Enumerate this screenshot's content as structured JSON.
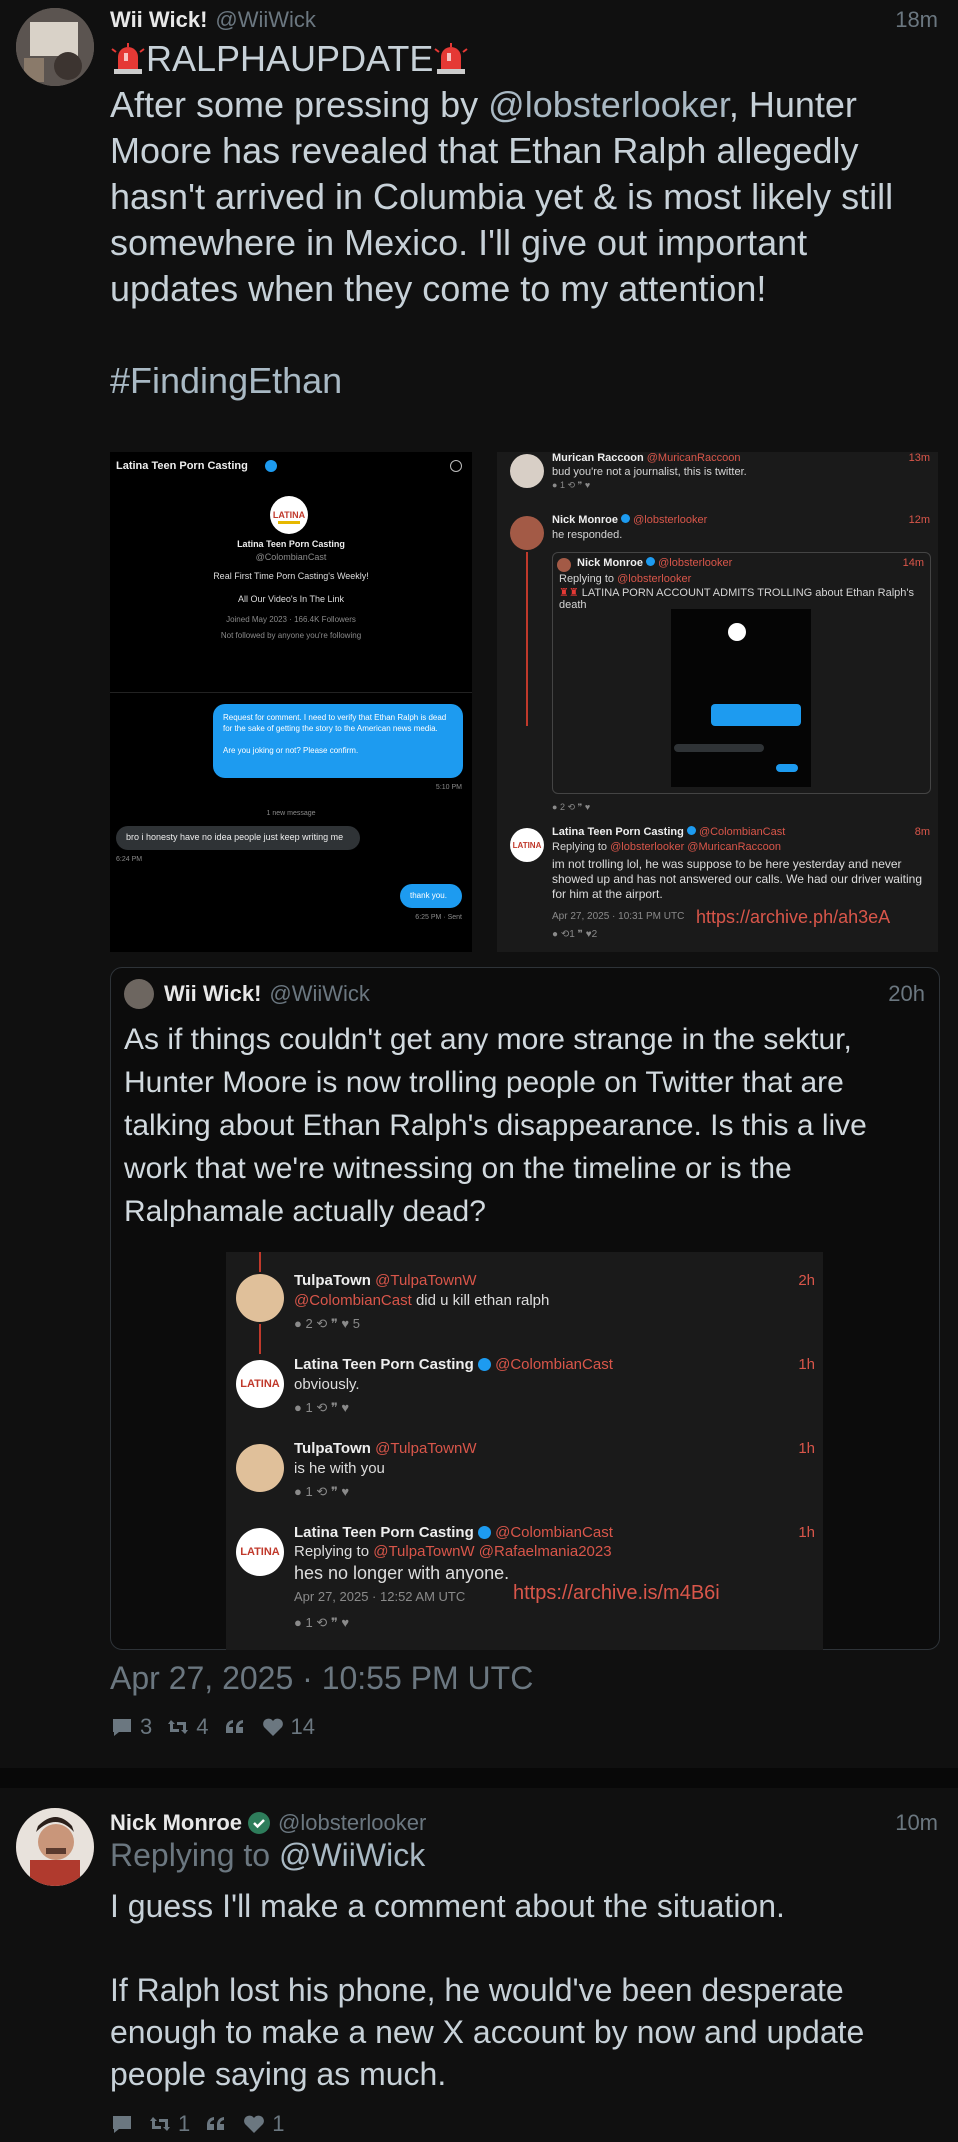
{
  "tweet1": {
    "fullname": "Wii Wick!",
    "handle": "@WiiWick",
    "time": "18m",
    "headline": "RALPHAUPDATE",
    "text_before_mention": "After some pressing by ",
    "mention": "@lobsterlooker",
    "text_after_mention": ", Hunter Moore has revealed that Ethan Ralph allegedly hasn't arrived in Columbia yet & is most likely still somewhere in Mexico. I'll give out important updates when they come to my attention!",
    "hashtag": "#FindingEthan",
    "date": "Apr 27, 2025 · 10:55 PM UTC",
    "stats": {
      "replies": "3",
      "retweets": "4",
      "quotes": "",
      "likes": "14"
    }
  },
  "left_image": {
    "profile_name": "Latina Teen Porn Casting",
    "profile_handle": "@ColombianCast",
    "bio1": "Real First Time Porn Casting's Weekly!",
    "bio2": "All Our Video's In The Link",
    "joined": "Joined May 2023 · 166.4K Followers",
    "not_followed": "Not followed by anyone you're following",
    "sent_msg": "Request for comment. I need to verify that Ethan Ralph is dead for the sake of getting the story to the American news media.\n\nAre you joking or not? Please confirm.",
    "sent_time": "5:10 PM",
    "new_message": "1 new message",
    "recv_msg": "bro i honesty have no idea people just keep writing me",
    "recv_time": "6:24 PM",
    "thank_you": "thank you.",
    "thank_time": "6:25 PM · Sent"
  },
  "right_image": {
    "r1_name": "Murican Raccoon",
    "r1_handle": "@MuricanRaccoon",
    "r1_time": "13m",
    "r1_text": "bud you're not a journalist, this is twitter.",
    "r1_stats": "1",
    "r2_name": "Nick Monroe",
    "r2_handle": "@lobsterlooker",
    "r2_time": "12m",
    "r2_text": "he responded.",
    "r3_name": "Nick Monroe",
    "r3_handle": "@lobsterlooker",
    "r3_time": "14m",
    "r3_replying": "Replying to",
    "r3_replying_handle": "@lobsterlooker",
    "r3_text": "LATINA PORN ACCOUNT ADMITS TROLLING about Ethan Ralph's death",
    "r3_stats": "2",
    "r4_name": "Latina Teen Porn Casting",
    "r4_handle": "@ColombianCast",
    "r4_time": "8m",
    "r4_replying": "Replying to",
    "r4_replying_handles": "@lobsterlooker @MuricanRaccoon",
    "r4_text": "im not trolling lol, he was suppose to be here yesterday and never showed up and has not answered our calls. We had our driver waiting for him at the airport.",
    "r4_date": "Apr 27, 2025 · 10:31 PM UTC",
    "r4_archive": "https://archive.ph/ah3eA",
    "r4_rts": "1",
    "r4_likes": "2"
  },
  "quote": {
    "fullname": "Wii Wick!",
    "handle": "@WiiWick",
    "time": "20h",
    "text": "As if things couldn't get any more strange in the sektur, Hunter Moore is now trolling people on Twitter that are talking about Ethan Ralph's disappearance. Is this a live work that we're witnessing on the timeline or is the Ralphamale actually dead?",
    "img": {
      "q1_name": "TulpaTown",
      "q1_handle": "@TulpaTownW",
      "q1_time": "2h",
      "q1_mention": "@ColombianCast",
      "q1_text": " did u kill ethan ralph",
      "q1_replies": "2",
      "q1_likes": "5",
      "q2_name": "Latina Teen Porn Casting",
      "q2_handle": "@ColombianCast",
      "q2_time": "1h",
      "q2_text": "obviously.",
      "q2_replies": "1",
      "q3_name": "TulpaTown",
      "q3_handle": "@TulpaTownW",
      "q3_time": "1h",
      "q3_text": "is he with you",
      "q3_replies": "1",
      "q4_name": "Latina Teen Porn Casting",
      "q4_handle": "@ColombianCast",
      "q4_time": "1h",
      "q4_replying": "Replying to",
      "q4_replying_handles": "@TulpaTownW @Rafaelmania2023",
      "q4_text": "hes no longer with anyone.",
      "q4_date": "Apr 27, 2025 · 12:52 AM UTC",
      "q4_archive": "https://archive.is/m4B6i",
      "q4_replies": "1"
    }
  },
  "tweet2": {
    "fullname": "Nick Monroe",
    "handle": "@lobsterlooker",
    "time": "10m",
    "replying_label": "Replying to",
    "replying_handle": "@WiiWick",
    "text": "I guess I'll make a comment about the situation.\n\nIf Ralph lost his phone, he would've been desperate enough to make a new X account by now and update people saying as much.",
    "stats": {
      "replies": "",
      "retweets": "1",
      "quotes": "",
      "likes": "1"
    }
  },
  "colors": {
    "background": "#101010",
    "accent_red": "#d9564a",
    "link": "#a9b9c4",
    "verified": "#1d9bf0"
  },
  "icons": [
    "siren-icon",
    "reply-icon",
    "retweet-icon",
    "quote-icon",
    "heart-icon",
    "verified-icon"
  ]
}
